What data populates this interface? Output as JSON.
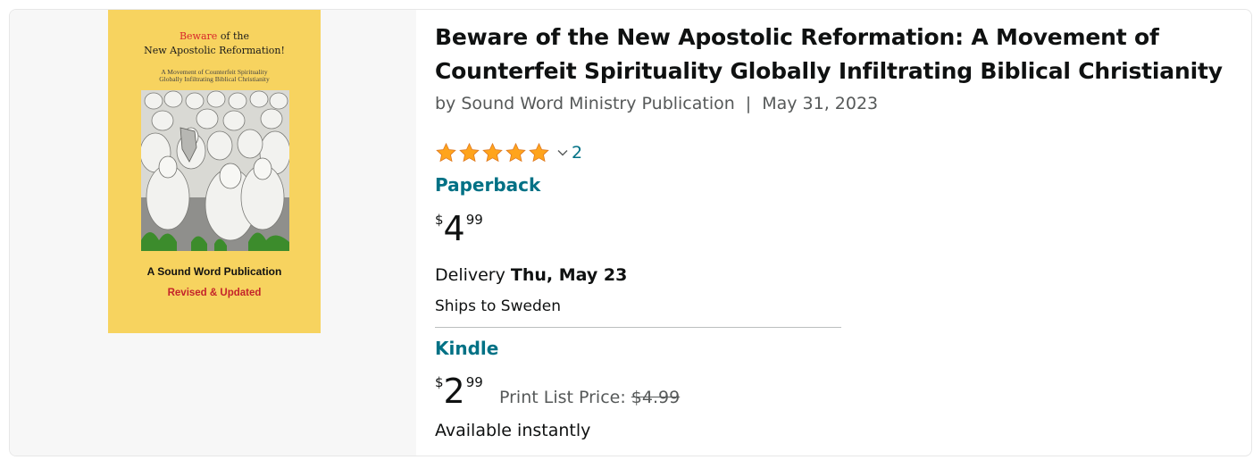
{
  "book": {
    "title": "Beware of the New Apostolic Reformation: A Movement of Counterfeit Spirituality Globally Infiltrating Biblical Christianity",
    "byline": "by Sound Word Ministry Publication",
    "separator": "|",
    "date": "May 31, 2023",
    "cover": {
      "title_red": "Beware",
      "title_rest": "of the",
      "title_line2": "New Apostolic Reformation!",
      "subtitle_line1": "A Movement of Counterfeit Spirituality",
      "subtitle_line2": "Globally Infiltrating Biblical Christianity",
      "publisher": "A Sound Word Publication",
      "revised": "Revised & Updated",
      "background_color": "#f7d35f"
    }
  },
  "rating": {
    "stars": 5,
    "max_stars": 5,
    "count": "2",
    "star_icon": "star-icon",
    "star_color": "#ffa41c"
  },
  "paperback": {
    "format": "Paperback",
    "currency": "$",
    "price_whole": "4",
    "price_fraction": "99",
    "delivery_prefix": "Delivery",
    "delivery_date": "Thu, May 23",
    "ships_to": "Ships to Sweden"
  },
  "kindle": {
    "format": "Kindle",
    "currency": "$",
    "price_whole": "2",
    "price_fraction": "99",
    "list_price_label": "Print List Price:",
    "list_price": "$4.99",
    "availability": "Available instantly"
  },
  "colors": {
    "link": "#007185",
    "muted": "#565959",
    "text": "#0f1111"
  }
}
